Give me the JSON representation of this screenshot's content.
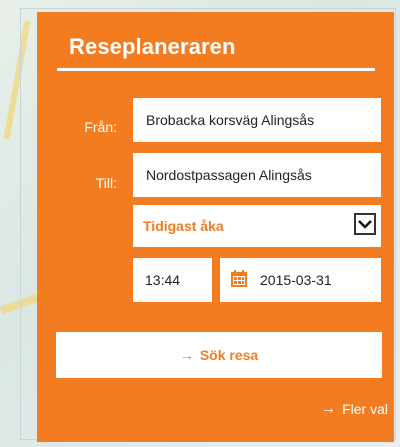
{
  "planner": {
    "title": "Reseplaneraren",
    "from_label": "Från:",
    "from_value": "Brobacka korsväg Alingsås",
    "to_label": "Till:",
    "to_value": "Nordostpassagen Alingsås",
    "timing_selected": "Tidigast åka",
    "time_value": "13:44",
    "date_value": "2015-03-31",
    "search_arrow": "→",
    "search_label": "Sök resa",
    "more_arrow": "→",
    "more_label": "Fler val"
  },
  "colors": {
    "accent": "#f47c20",
    "text_on_accent": "#ffffff"
  },
  "icons": {
    "select_arrow": "chevron-down-icon",
    "calendar": "calendar-icon",
    "search_arrow": "arrow-right-icon",
    "more_arrow": "arrow-right-icon"
  }
}
